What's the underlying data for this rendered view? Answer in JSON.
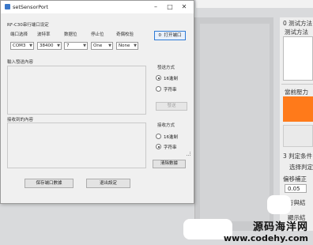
{
  "dialog": {
    "title": "setSensorPort",
    "serial_settings": {
      "group_label": "RF-C30串行端口设定",
      "port_label": "端口选择",
      "port_value": "COM3",
      "baud_label": "波特率",
      "baud_value": "38400",
      "databits_label": "数据位",
      "databits_value": "7",
      "stopbits_label": "停止位",
      "stopbits_value": "One",
      "parity_label": "奇偶校验",
      "parity_value": "None",
      "open_button": "打开端口",
      "open_indicator": "0"
    },
    "send": {
      "label": "輸入發送內容",
      "mode_label": "發送方式",
      "opt_hex": "16進制",
      "opt_str": "字符串",
      "send_button": "發送"
    },
    "receive": {
      "label": "接收到的內容",
      "mode_label": "接收方式",
      "opt_hex": "16進制",
      "opt_str": "字符串",
      "clear_button": "清除數據"
    },
    "footer": {
      "save_button": "保存端口數據",
      "exit_button": "退出設定"
    }
  },
  "background_app": {
    "test_method_1": "0 测试方法",
    "test_method_2": "测试方法",
    "current_pressure": "當前壓力",
    "judge_condition": "3 判定条件",
    "select_judge": "选择判定",
    "offset_label": "偏移補正",
    "offset_value": "0.05",
    "partial_a": "行與結",
    "partial_b": "顯示結"
  },
  "watermark": {
    "cn": "源码海洋网",
    "url": "www.codehy.com"
  },
  "colors": {
    "pressure_box": "#ff7a1a",
    "accent_border": "#2f7bd6"
  }
}
